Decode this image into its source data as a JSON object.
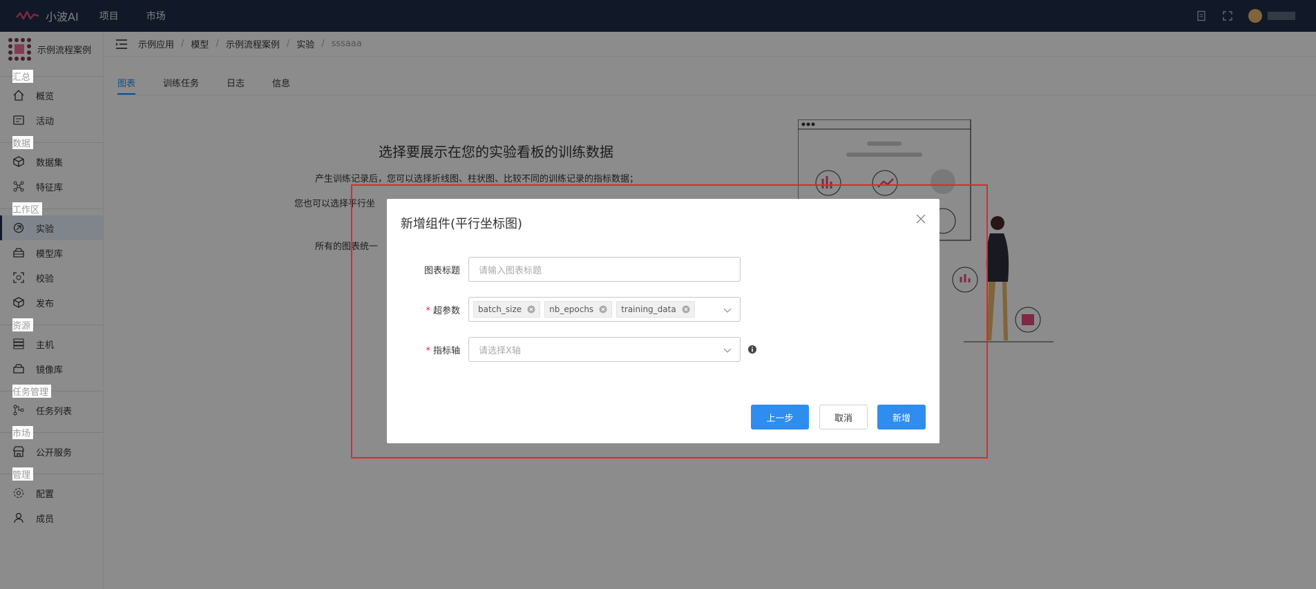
{
  "topbar": {
    "app_name": "小波AI",
    "nav": [
      "项目",
      "市场"
    ]
  },
  "sidebar": {
    "project_name": "示例流程案例",
    "groups": [
      {
        "title": "汇总",
        "items": [
          {
            "label": "概览",
            "icon": "home-icon"
          },
          {
            "label": "活动",
            "icon": "activity-icon"
          }
        ]
      },
      {
        "title": "数据",
        "items": [
          {
            "label": "数据集",
            "icon": "cube-icon"
          },
          {
            "label": "特征库",
            "icon": "molecule-icon"
          }
        ]
      },
      {
        "title": "工作区",
        "items": [
          {
            "label": "实验",
            "icon": "experiment-icon"
          },
          {
            "label": "模型库",
            "icon": "model-icon"
          },
          {
            "label": "校验",
            "icon": "scan-icon"
          },
          {
            "label": "发布",
            "icon": "box-icon"
          }
        ]
      },
      {
        "title": "资源",
        "items": [
          {
            "label": "主机",
            "icon": "server-icon"
          },
          {
            "label": "镜像库",
            "icon": "image-store-icon"
          }
        ]
      },
      {
        "title": "任务管理",
        "items": [
          {
            "label": "任务列表",
            "icon": "task-icon"
          }
        ]
      },
      {
        "title": "市场",
        "items": [
          {
            "label": "公开服务",
            "icon": "store-icon"
          }
        ]
      },
      {
        "title": "管理",
        "items": [
          {
            "label": "配置",
            "icon": "gear-icon"
          },
          {
            "label": "成员",
            "icon": "user-icon"
          }
        ]
      }
    ]
  },
  "breadcrumb": [
    "示例应用",
    "模型",
    "示例流程案例",
    "实验",
    "sssaaa"
  ],
  "tabs": [
    "图表",
    "训练任务",
    "日志",
    "信息"
  ],
  "empty_state": {
    "title": "选择要展示在您的实验看板的训练数据",
    "line1": "产生训练记录后，您可以选择折线图、柱状图、比较不同的训练记录的指标数据；",
    "line2": "您也可以选择平行坐",
    "line3": "所有的图表统一"
  },
  "modal": {
    "title": "新增组件(平行坐标图)",
    "fields": {
      "chart_title_label": "图表标题",
      "chart_title_placeholder": "请输入图表标题",
      "hyperparams_label": "超参数",
      "hyperparams_tags": [
        "batch_size",
        "nb_epochs",
        "training_data"
      ],
      "metric_axis_label": "指标轴",
      "metric_axis_placeholder": "请选择X轴"
    },
    "buttons": {
      "prev": "上一步",
      "cancel": "取消",
      "add": "新增"
    }
  },
  "colors": {
    "topbar": "#1f2d48",
    "primary": "#2f8df0",
    "required": "#f5222d",
    "highlight_box": "#e8232b"
  }
}
